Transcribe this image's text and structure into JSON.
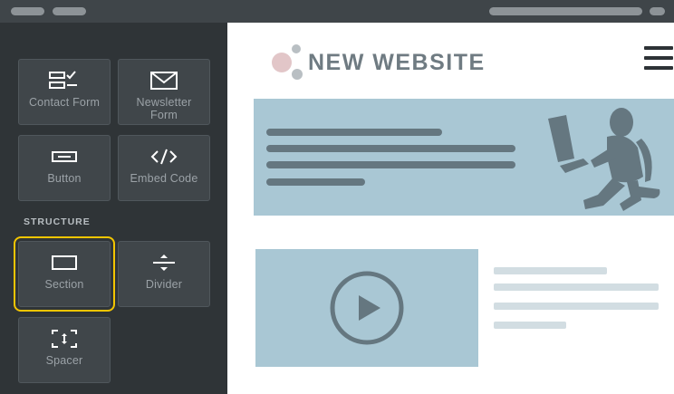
{
  "sidebar": {
    "tiles": [
      {
        "label": "Contact Form",
        "icon": "contact-form-icon"
      },
      {
        "label": "Newsletter Form",
        "icon": "envelope-icon"
      },
      {
        "label": "Button",
        "icon": "button-icon"
      },
      {
        "label": "Embed Code",
        "icon": "code-icon"
      }
    ],
    "structure_title": "STRUCTURE",
    "structure_tiles": [
      {
        "label": "Section",
        "icon": "section-icon",
        "selected": true
      },
      {
        "label": "Divider",
        "icon": "divider-icon"
      },
      {
        "label": "Spacer",
        "icon": "spacer-icon"
      }
    ]
  },
  "canvas": {
    "site_title": "NEW WEBSITE",
    "hero_illustration": "person-at-computer-icon",
    "video_icon": "play-icon",
    "menu_icon": "hamburger-menu-icon"
  },
  "colors": {
    "accent_selection": "#f3c500",
    "hero_bg": "#a9c7d4",
    "sidebar_bg": "#2f3437"
  }
}
